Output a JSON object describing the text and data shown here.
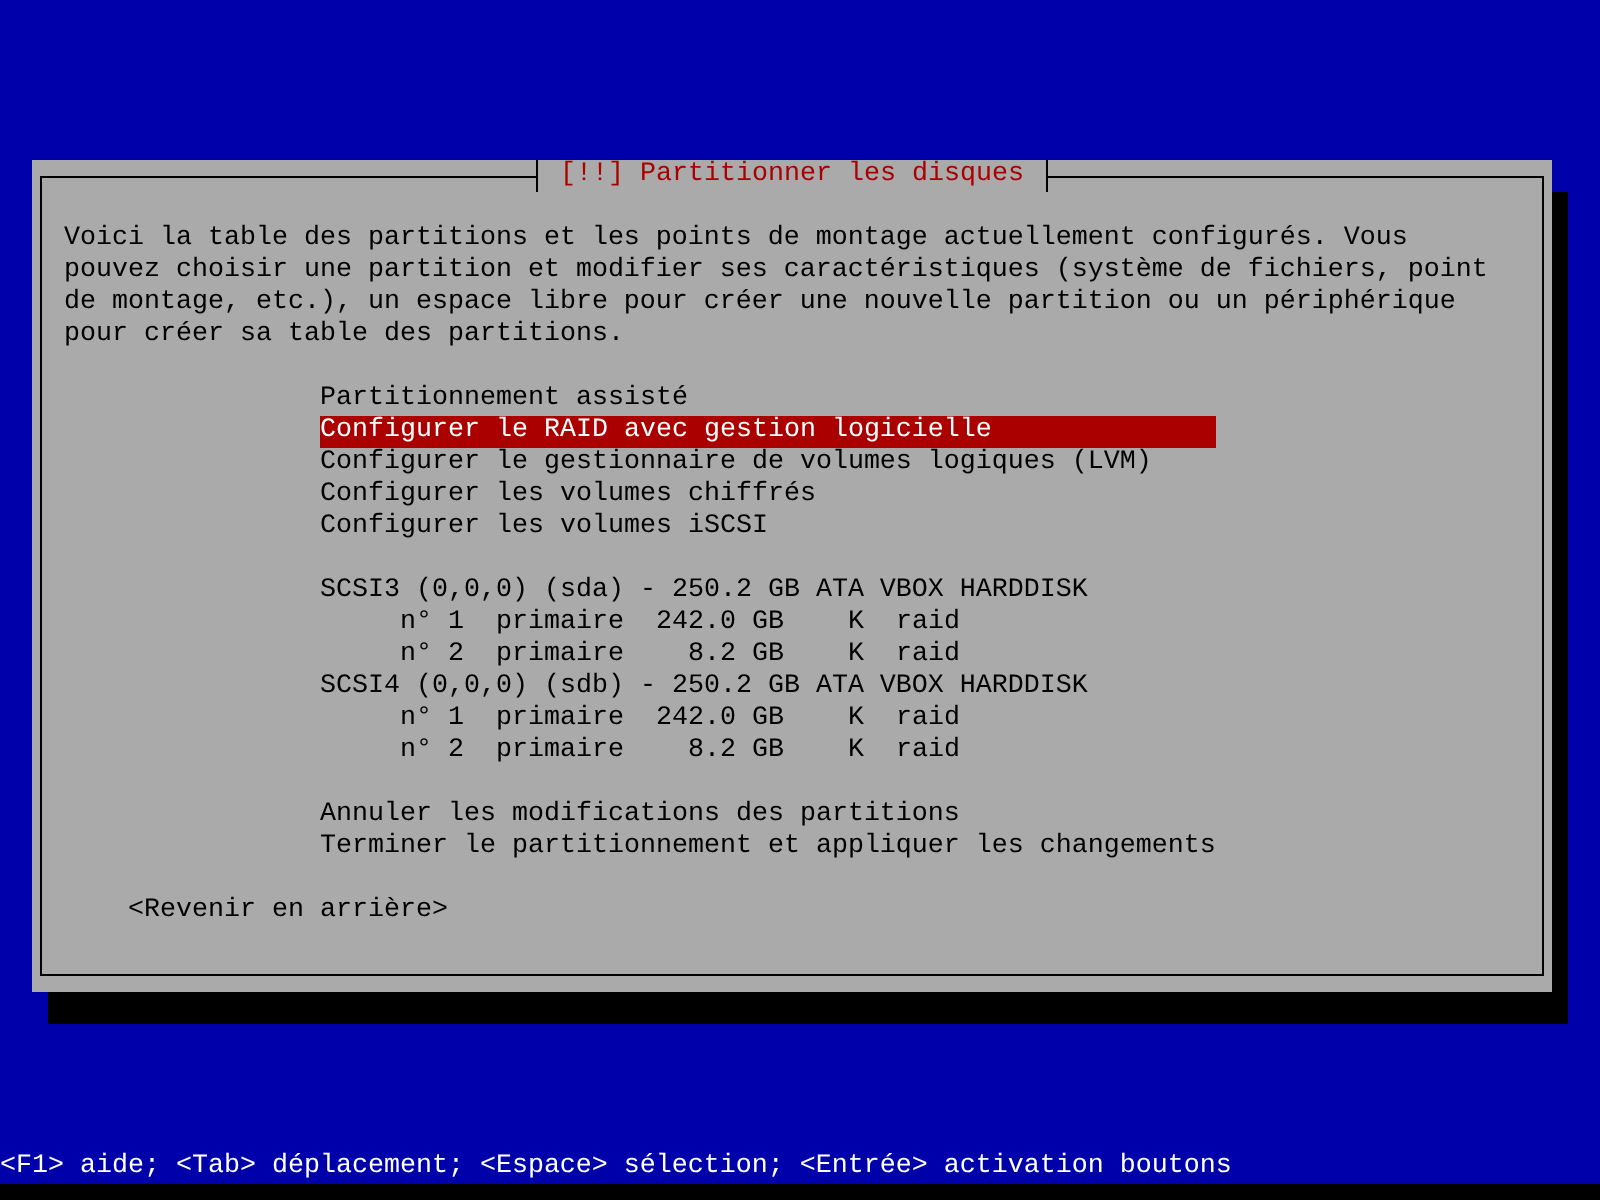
{
  "dialog": {
    "title": "[!!] Partitionner les disques",
    "message": "Voici la table des partitions et les points de montage actuellement configurés. Vous pouvez choisir une partition et modifier ses caractéristiques (système de fichiers, point de montage, etc.), un espace libre pour créer une nouvelle partition ou un périphérique pour créer sa table des partitions.",
    "menu_sections": [
      {
        "items": [
          {
            "label": "Partitionnement assisté",
            "selected": false
          },
          {
            "label": "Configurer le RAID avec gestion logicielle",
            "selected": true
          },
          {
            "label": "Configurer le gestionnaire de volumes logiques (LVM)",
            "selected": false
          },
          {
            "label": "Configurer les volumes chiffrés",
            "selected": false
          },
          {
            "label": "Configurer les volumes iSCSI",
            "selected": false
          }
        ]
      },
      {
        "items": [
          {
            "label": "SCSI3 (0,0,0) (sda) - 250.2 GB ATA VBOX HARDDISK",
            "selected": false,
            "children": [
              {
                "number": "n° 1",
                "type": "primaire",
                "size": "242.0 GB",
                "flag": "K",
                "filesystem": "raid",
                "selected": false
              },
              {
                "number": "n° 2",
                "type": "primaire",
                "size": "8.2 GB",
                "flag": "K",
                "filesystem": "raid",
                "selected": false
              }
            ]
          },
          {
            "label": "SCSI4 (0,0,0) (sdb) - 250.2 GB ATA VBOX HARDDISK",
            "selected": false,
            "children": [
              {
                "number": "n° 1",
                "type": "primaire",
                "size": "242.0 GB",
                "flag": "K",
                "filesystem": "raid",
                "selected": false
              },
              {
                "number": "n° 2",
                "type": "primaire",
                "size": "8.2 GB",
                "flag": "K",
                "filesystem": "raid",
                "selected": false
              }
            ]
          }
        ]
      },
      {
        "items": [
          {
            "label": "Annuler les modifications des partitions",
            "selected": false
          },
          {
            "label": "Terminer le partitionnement et appliquer les changements",
            "selected": false
          }
        ]
      }
    ],
    "back_button": {
      "label": "<Revenir en arrière>"
    }
  },
  "help_line": "<F1> aide; <Tab> déplacement; <Espace> sélection; <Entrée> activation boutons"
}
